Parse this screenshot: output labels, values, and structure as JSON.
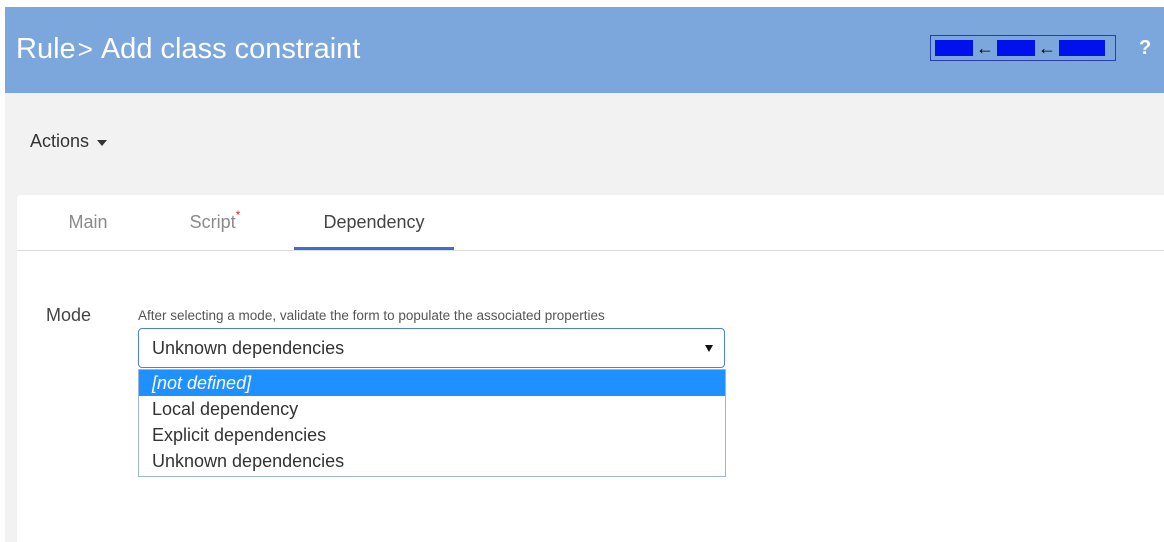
{
  "header": {
    "breadcrumb": "Rule",
    "separator": ">",
    "title": "Add class constraint",
    "help_label": "?",
    "nav_arrow_1": "←",
    "nav_arrow_2": "←"
  },
  "toolbar": {
    "actions_label": "Actions"
  },
  "tabs": [
    {
      "label": "Main",
      "required_mark": ""
    },
    {
      "label": "Script",
      "required_mark": "*"
    },
    {
      "label": "Dependency",
      "required_mark": ""
    }
  ],
  "form": {
    "mode_label": "Mode",
    "mode_hint": "After selecting a mode, validate the form to populate the associated properties",
    "mode_value": "Unknown dependencies",
    "mode_options": [
      "[not defined]",
      "Local dependency",
      "Explicit dependencies",
      "Unknown dependencies"
    ]
  },
  "colors": {
    "header_bg": "#7ba7dc",
    "active_tab_underline": "#3d6fd3",
    "required_mark": "#d9262e",
    "highlight_option": "#1e90ff",
    "nav_block": "#0011ee"
  }
}
